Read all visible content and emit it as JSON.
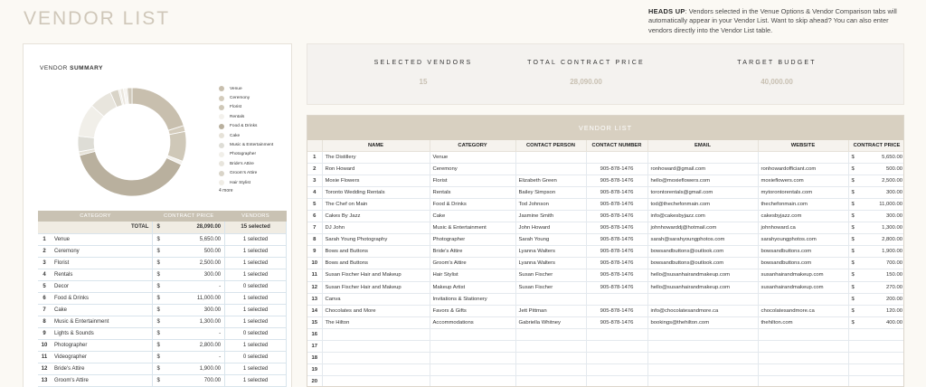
{
  "page_title": "VENDOR LIST",
  "heads_up": {
    "label": "HEADS UP",
    "text": ": Vendors selected in the Venue Options & Vendor Comparison tabs will automatically appear in your Vendor List. Want to skip ahead? You can also enter vendors directly into the Vendor List table."
  },
  "summary": {
    "title_prefix": "VENDOR ",
    "title_bold": "SUMMARY",
    "legend": [
      {
        "label": "Venue",
        "color": "#c8bfae"
      },
      {
        "label": "Ceremony",
        "color": "#d4ccbc"
      },
      {
        "label": "Florist",
        "color": "#cfc8b8"
      },
      {
        "label": "Rentals",
        "color": "#f3f1ec"
      },
      {
        "label": "Food & Drinks",
        "color": "#b9b09e"
      },
      {
        "label": "Cake",
        "color": "#e6e2d8"
      },
      {
        "label": "Music & Entertainment",
        "color": "#deddd6"
      },
      {
        "label": "Photographer",
        "color": "#f1efe9"
      },
      {
        "label": "Bride's Attire",
        "color": "#e8e5dd"
      },
      {
        "label": "Groom's Attire",
        "color": "#d9d4c8"
      },
      {
        "label": "Hair Stylist",
        "color": "#f0ede6"
      }
    ],
    "legend_more": "4 more",
    "chart_data": {
      "type": "pie",
      "categories": [
        "Venue",
        "Ceremony",
        "Florist",
        "Rentals",
        "Food & Drinks",
        "Cake",
        "Music & Entertainment",
        "Photographer",
        "Bride's Attire",
        "Groom's Attire",
        "Hair Stylist",
        "Makeup Artist",
        "Invitations & Stationery",
        "Favors & Gifts",
        "Accommodations"
      ],
      "values": [
        5650,
        500,
        2500,
        300,
        11000,
        300,
        1300,
        2800,
        1900,
        700,
        150,
        270,
        200,
        120,
        400
      ],
      "colors": [
        "#c8bfae",
        "#d4ccbc",
        "#cfc8b8",
        "#f3f1ec",
        "#b9b09e",
        "#e6e2d8",
        "#deddd6",
        "#f1efe9",
        "#e8e5dd",
        "#d9d4c8",
        "#f0ede6",
        "#ebe7df",
        "#f5f3ef",
        "#e3ded3",
        "#d0c9bb"
      ]
    },
    "table": {
      "headers": [
        "CATEGORY",
        "CONTRACT PRICE",
        "VENDORS"
      ],
      "total": {
        "label": "TOTAL",
        "dollar": "$",
        "price": "28,090.00",
        "vendors": "15 selected"
      },
      "rows": [
        {
          "num": "1",
          "category": "Venue",
          "dollar": "$",
          "price": "5,650.00",
          "vendors": "1 selected"
        },
        {
          "num": "2",
          "category": "Ceremony",
          "dollar": "$",
          "price": "500.00",
          "vendors": "1 selected"
        },
        {
          "num": "3",
          "category": "Florist",
          "dollar": "$",
          "price": "2,500.00",
          "vendors": "1 selected"
        },
        {
          "num": "4",
          "category": "Rentals",
          "dollar": "$",
          "price": "300.00",
          "vendors": "1 selected"
        },
        {
          "num": "5",
          "category": "Decor",
          "dollar": "$",
          "price": "-",
          "vendors": "0 selected"
        },
        {
          "num": "6",
          "category": "Food & Drinks",
          "dollar": "$",
          "price": "11,000.00",
          "vendors": "1 selected"
        },
        {
          "num": "7",
          "category": "Cake",
          "dollar": "$",
          "price": "300.00",
          "vendors": "1 selected"
        },
        {
          "num": "8",
          "category": "Music & Entertainment",
          "dollar": "$",
          "price": "1,300.00",
          "vendors": "1 selected"
        },
        {
          "num": "9",
          "category": "Lights & Sounds",
          "dollar": "$",
          "price": "-",
          "vendors": "0 selected"
        },
        {
          "num": "10",
          "category": "Photographer",
          "dollar": "$",
          "price": "2,800.00",
          "vendors": "1 selected"
        },
        {
          "num": "11",
          "category": "Videographer",
          "dollar": "$",
          "price": "-",
          "vendors": "0 selected"
        },
        {
          "num": "12",
          "category": "Bride's Attire",
          "dollar": "$",
          "price": "1,900.00",
          "vendors": "1 selected"
        },
        {
          "num": "13",
          "category": "Groom's Attire",
          "dollar": "$",
          "price": "700.00",
          "vendors": "1 selected"
        }
      ]
    }
  },
  "stats": [
    {
      "label": "SELECTED VENDORS",
      "value": "15"
    },
    {
      "label": "TOTAL CONTRACT PRICE",
      "value": "28,090.00"
    },
    {
      "label": "TARGET BUDGET",
      "value": "40,000.00"
    }
  ],
  "vendor_list": {
    "title": "VENDOR LIST",
    "headers": [
      "",
      "NAME",
      "CATEGORY",
      "CONTACT PERSON",
      "CONTACT NUMBER",
      "EMAIL",
      "WEBSITE",
      "CONTRACT PRICE"
    ],
    "rows": [
      {
        "num": "1",
        "name": "The Distillery",
        "category": "Venue",
        "contact": "",
        "phone": "",
        "email": "",
        "website": "",
        "dollar": "$",
        "price": "5,650.00"
      },
      {
        "num": "2",
        "name": "Ron Howard",
        "category": "Ceremony",
        "contact": "",
        "phone": "905-878-1476",
        "email": "ronhoward@gmail.com",
        "website": "ronhowardofficiant.com",
        "dollar": "$",
        "price": "500.00"
      },
      {
        "num": "3",
        "name": "Moxie Flowers",
        "category": "Florist",
        "contact": "Elizabeth Green",
        "phone": "905-878-1476",
        "email": "hello@moxieflowers.com",
        "website": "moxieflowers.com",
        "dollar": "$",
        "price": "2,500.00"
      },
      {
        "num": "4",
        "name": "Toronto Wedding Rentals",
        "category": "Rentals",
        "contact": "Bailey Simpson",
        "phone": "905-878-1476",
        "email": "torontorentals@gmail.com",
        "website": "mytorontorentals.com",
        "dollar": "$",
        "price": "300.00"
      },
      {
        "num": "5",
        "name": "The Chef on Main",
        "category": "Food & Drinks",
        "contact": "Tod Johnson",
        "phone": "905-878-1476",
        "email": "tod@thechefonmain.com",
        "website": "thechefonmain.com",
        "dollar": "$",
        "price": "11,000.00"
      },
      {
        "num": "6",
        "name": "Cakes By Jazz",
        "category": "Cake",
        "contact": "Jasmine Smith",
        "phone": "905-878-1476",
        "email": "info@cakesbyjazz.com",
        "website": "cakesbyjazz.com",
        "dollar": "$",
        "price": "300.00"
      },
      {
        "num": "7",
        "name": "DJ John",
        "category": "Music & Entertainment",
        "contact": "John Howard",
        "phone": "905-878-1476",
        "email": "johnhowarddj@hotmail.com",
        "website": "johnhoward.ca",
        "dollar": "$",
        "price": "1,300.00"
      },
      {
        "num": "8",
        "name": "Sarah Young Photography",
        "category": "Photographer",
        "contact": "Sarah Young",
        "phone": "905-878-1476",
        "email": "sarah@sarahyoungphotos.com",
        "website": "sarahyoungphotos.com",
        "dollar": "$",
        "price": "2,800.00"
      },
      {
        "num": "9",
        "name": "Bows and Buttons",
        "category": "Bride's Attire",
        "contact": "Lyanna Walters",
        "phone": "905-878-1476",
        "email": "bowsandbuttons@outlook.com",
        "website": "bowsandbuttons.com",
        "dollar": "$",
        "price": "1,900.00"
      },
      {
        "num": "10",
        "name": "Bows and Buttons",
        "category": "Groom's Attire",
        "contact": "Lyanna Walters",
        "phone": "905-878-1476",
        "email": "bowsandbuttons@outlook.com",
        "website": "bowsandbuttons.com",
        "dollar": "$",
        "price": "700.00"
      },
      {
        "num": "11",
        "name": "Susan Fischer Hair and Makeup",
        "category": "Hair Stylist",
        "contact": "Susan Fischer",
        "phone": "905-878-1476",
        "email": "hello@susanhairandmakeup.com",
        "website": "susanhairandmakeup.com",
        "dollar": "$",
        "price": "150.00"
      },
      {
        "num": "12",
        "name": "Susan Fischer Hair and Makeup",
        "category": "Makeup Artist",
        "contact": "Susan Fischer",
        "phone": "905-878-1476",
        "email": "hello@susanhairandmakeup.com",
        "website": "susanhairandmakeup.com",
        "dollar": "$",
        "price": "270.00"
      },
      {
        "num": "13",
        "name": "Canva",
        "category": "Invitations & Stationery",
        "contact": "",
        "phone": "",
        "email": "",
        "website": "",
        "dollar": "$",
        "price": "200.00"
      },
      {
        "num": "14",
        "name": "Chocolates and More",
        "category": "Favors & Gifts",
        "contact": "Jett Pittman",
        "phone": "905-878-1476",
        "email": "info@chocolatesandmore.ca",
        "website": "chocolatesandmore.ca",
        "dollar": "$",
        "price": "120.00"
      },
      {
        "num": "15",
        "name": "The Hilton",
        "category": "Accommodations",
        "contact": "Gabriella Whitney",
        "phone": "905-878-1476",
        "email": "bookings@thehilton.com",
        "website": "thehilton.com",
        "dollar": "$",
        "price": "400.00"
      },
      {
        "num": "16",
        "name": "",
        "category": "",
        "contact": "",
        "phone": "",
        "email": "",
        "website": "",
        "dollar": "",
        "price": ""
      },
      {
        "num": "17",
        "name": "",
        "category": "",
        "contact": "",
        "phone": "",
        "email": "",
        "website": "",
        "dollar": "",
        "price": ""
      },
      {
        "num": "18",
        "name": "",
        "category": "",
        "contact": "",
        "phone": "",
        "email": "",
        "website": "",
        "dollar": "",
        "price": ""
      },
      {
        "num": "19",
        "name": "",
        "category": "",
        "contact": "",
        "phone": "",
        "email": "",
        "website": "",
        "dollar": "",
        "price": ""
      },
      {
        "num": "20",
        "name": "",
        "category": "",
        "contact": "",
        "phone": "",
        "email": "",
        "website": "",
        "dollar": "",
        "price": ""
      }
    ]
  }
}
